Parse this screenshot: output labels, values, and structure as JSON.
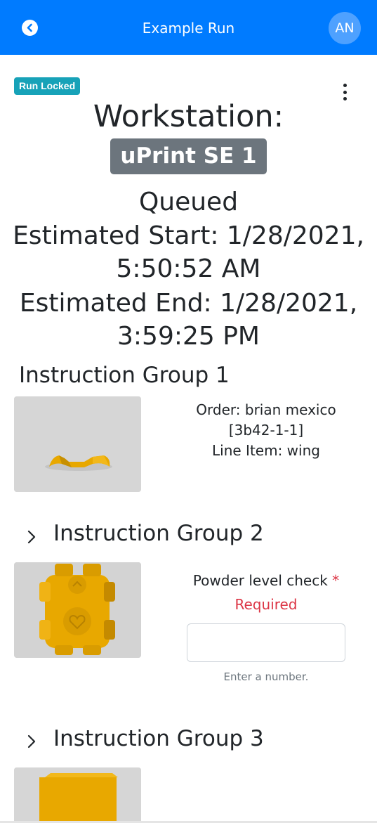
{
  "header": {
    "title": "Example Run",
    "avatar_initials": "AN",
    "back_icon": "chevron-left-circle-icon",
    "color": "#007bff"
  },
  "run": {
    "badge": "Run Locked",
    "badge_color": "#17a2b8",
    "menu_icon": "kebab-menu-icon",
    "workstation_label": "Workstation:",
    "workstation_name": "uPrint SE 1",
    "status": "Queued",
    "estimated_start_line1": "Estimated Start: 1/28/2021,",
    "estimated_start_line2": "5:50:52 AM",
    "estimated_end_line1": "Estimated End: 1/28/2021,",
    "estimated_end_line2": "3:59:25 PM"
  },
  "groups": [
    {
      "title": "Instruction Group 1",
      "order_line": "Order: brian mexico",
      "order_id": "[3b42-1-1]",
      "line_item": "Line Item: wing",
      "thumbnail": "wing-part-thumbnail"
    },
    {
      "title": "Instruction Group 2",
      "expand_icon": "chevron-right-icon",
      "thumbnail": "companion-cube-thumbnail",
      "field_label": "Powder level check",
      "required_marker": "*",
      "required_text": "Required",
      "input_value": "",
      "input_hint": "Enter a number."
    },
    {
      "title": "Instruction Group 3",
      "expand_icon": "chevron-right-icon",
      "thumbnail": "cube-part-thumbnail"
    }
  ]
}
